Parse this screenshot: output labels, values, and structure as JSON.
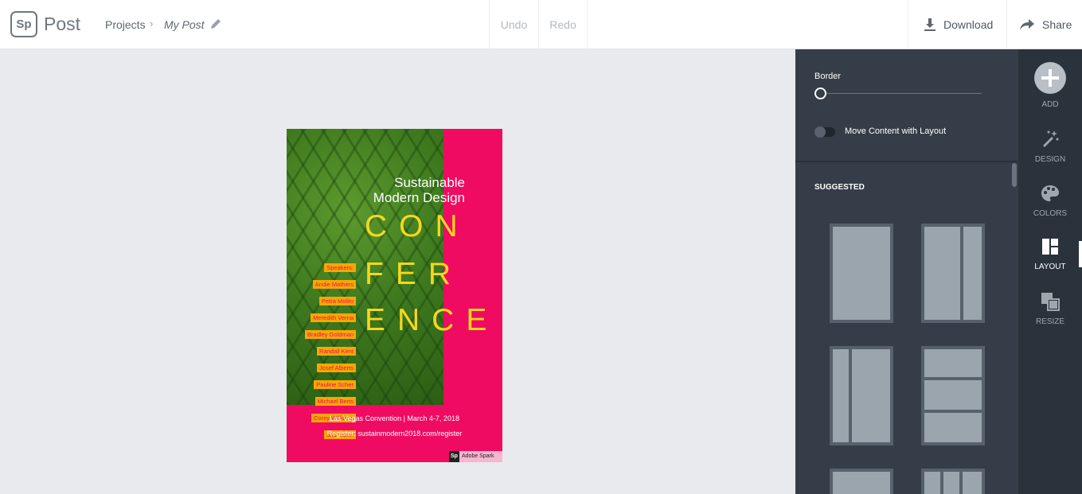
{
  "header": {
    "logo": "Sp",
    "app_name": "Post",
    "breadcrumb_projects": "Projects",
    "breadcrumb_sep": "›",
    "breadcrumb_current": "My Post",
    "undo": "Undo",
    "redo": "Redo",
    "download": "Download",
    "share": "Share"
  },
  "poster": {
    "title_line1": "Sustainable",
    "title_line2": "Modern Design",
    "word1": "CON",
    "word2": "FER",
    "word3": "ENCE",
    "speakers": [
      "Speakers:",
      "Andie Mathers",
      "Petra Molito",
      "Meredith Verna",
      "Bradley Goldman",
      "Randall Kent",
      "Josef Alberts",
      "Pauline Scher",
      "Michael Berts",
      "Corey Williams",
      "and more:"
    ],
    "footer1": "Las Vegas Convention | March 4-7, 2018",
    "footer2": "Register: sustainmodern2018.com/register",
    "badge_logo": "Sp",
    "badge_text": "Adobe Spark",
    "colors": {
      "background": "#ef0b62",
      "accent": "#f6d81a",
      "speaker_box": "#f7a800"
    }
  },
  "panel": {
    "border_label": "Border",
    "border_value": 0,
    "move_content_label": "Move Content with Layout",
    "move_content_on": false,
    "suggested_label": "SUGGESTED"
  },
  "rail": {
    "add": "ADD",
    "design": "DESIGN",
    "colors": "COLORS",
    "layout": "LAYOUT",
    "resize": "RESIZE",
    "active": "LAYOUT"
  }
}
